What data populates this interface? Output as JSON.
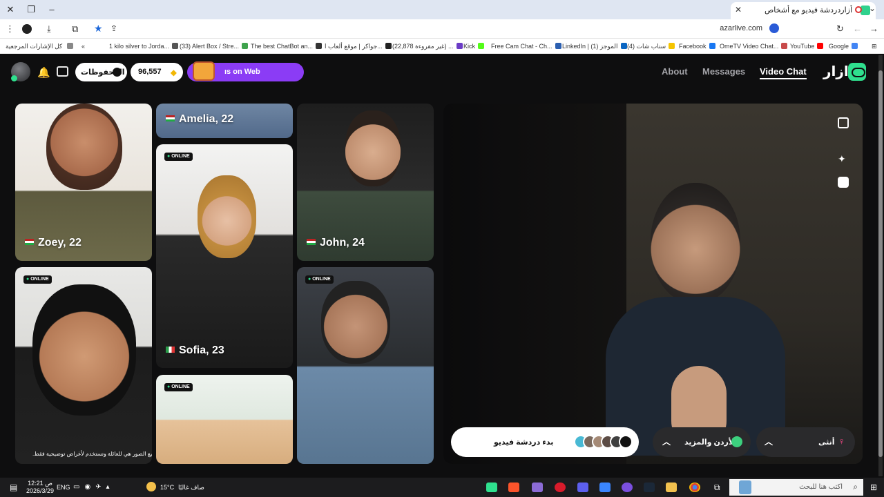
{
  "browser": {
    "tab_title": "أزاردردشة فيديو مع أشخاص",
    "url": "azarlive.com",
    "bookmarks": [
      {
        "label": "Google",
        "color": "#4285f4"
      },
      {
        "label": "YouTube",
        "color": "#ff0000"
      },
      {
        "label": "OmeTV Video Chat...",
        "color": "#c84a4a"
      },
      {
        "label": "Facebook",
        "color": "#1877f2"
      },
      {
        "label": "(4) سناب شات",
        "color": "#f5c400"
      },
      {
        "label": "LinkedIn | (1) الموجز",
        "color": "#0a66c2"
      },
      {
        "label": "Free Cam Chat - Ch...",
        "color": "#2b5fb0"
      },
      {
        "label": "Kick",
        "color": "#53fc18"
      },
      {
        "label": "(22,878 غير مقروءة) ...",
        "color": "#6b3cc6"
      },
      {
        "label": "جواكر | موقع ألعاب ا...",
        "color": "#222222"
      },
      {
        "label": "The best ChatBot an...",
        "color": "#333333"
      },
      {
        "label": "(33) Alert Box / Stre...",
        "color": "#3fa34d"
      },
      {
        "label": "1 kilo silver to Jorda...",
        "color": "#555555"
      }
    ],
    "all_bookmarks": "كل الإشارات المرجعية"
  },
  "nav": {
    "video_chat": "Video Chat",
    "messages": "Messages",
    "about": "About",
    "logo": "ازار",
    "gems": "96,557",
    "saved": "المحفوظات",
    "promo": "ıs on Web"
  },
  "profiles": [
    {
      "name": "Zoey, 22"
    },
    {
      "name": "Amelia, 22"
    },
    {
      "name": "John, 24"
    },
    {
      "name": "Sofia, 23"
    }
  ],
  "online_label": "ONLINE",
  "disclaimer": "جميع الصور هي للعائلة وتستخدم لأغراض توضيحية فقط.",
  "controls": {
    "gender": "أنثى",
    "region": "الأردن والمزيد",
    "start": "بدء دردشة فيديو"
  },
  "taskbar": {
    "search_placeholder": "اكتب هنا للبحث",
    "weather": "صاف غالبًا",
    "temp": "15°C",
    "lang": "ENG",
    "time": "12:21 ص",
    "date": "2026/3/29"
  },
  "colors": {
    "accent": "#2fe08e",
    "promo": "#8b3cf5"
  }
}
